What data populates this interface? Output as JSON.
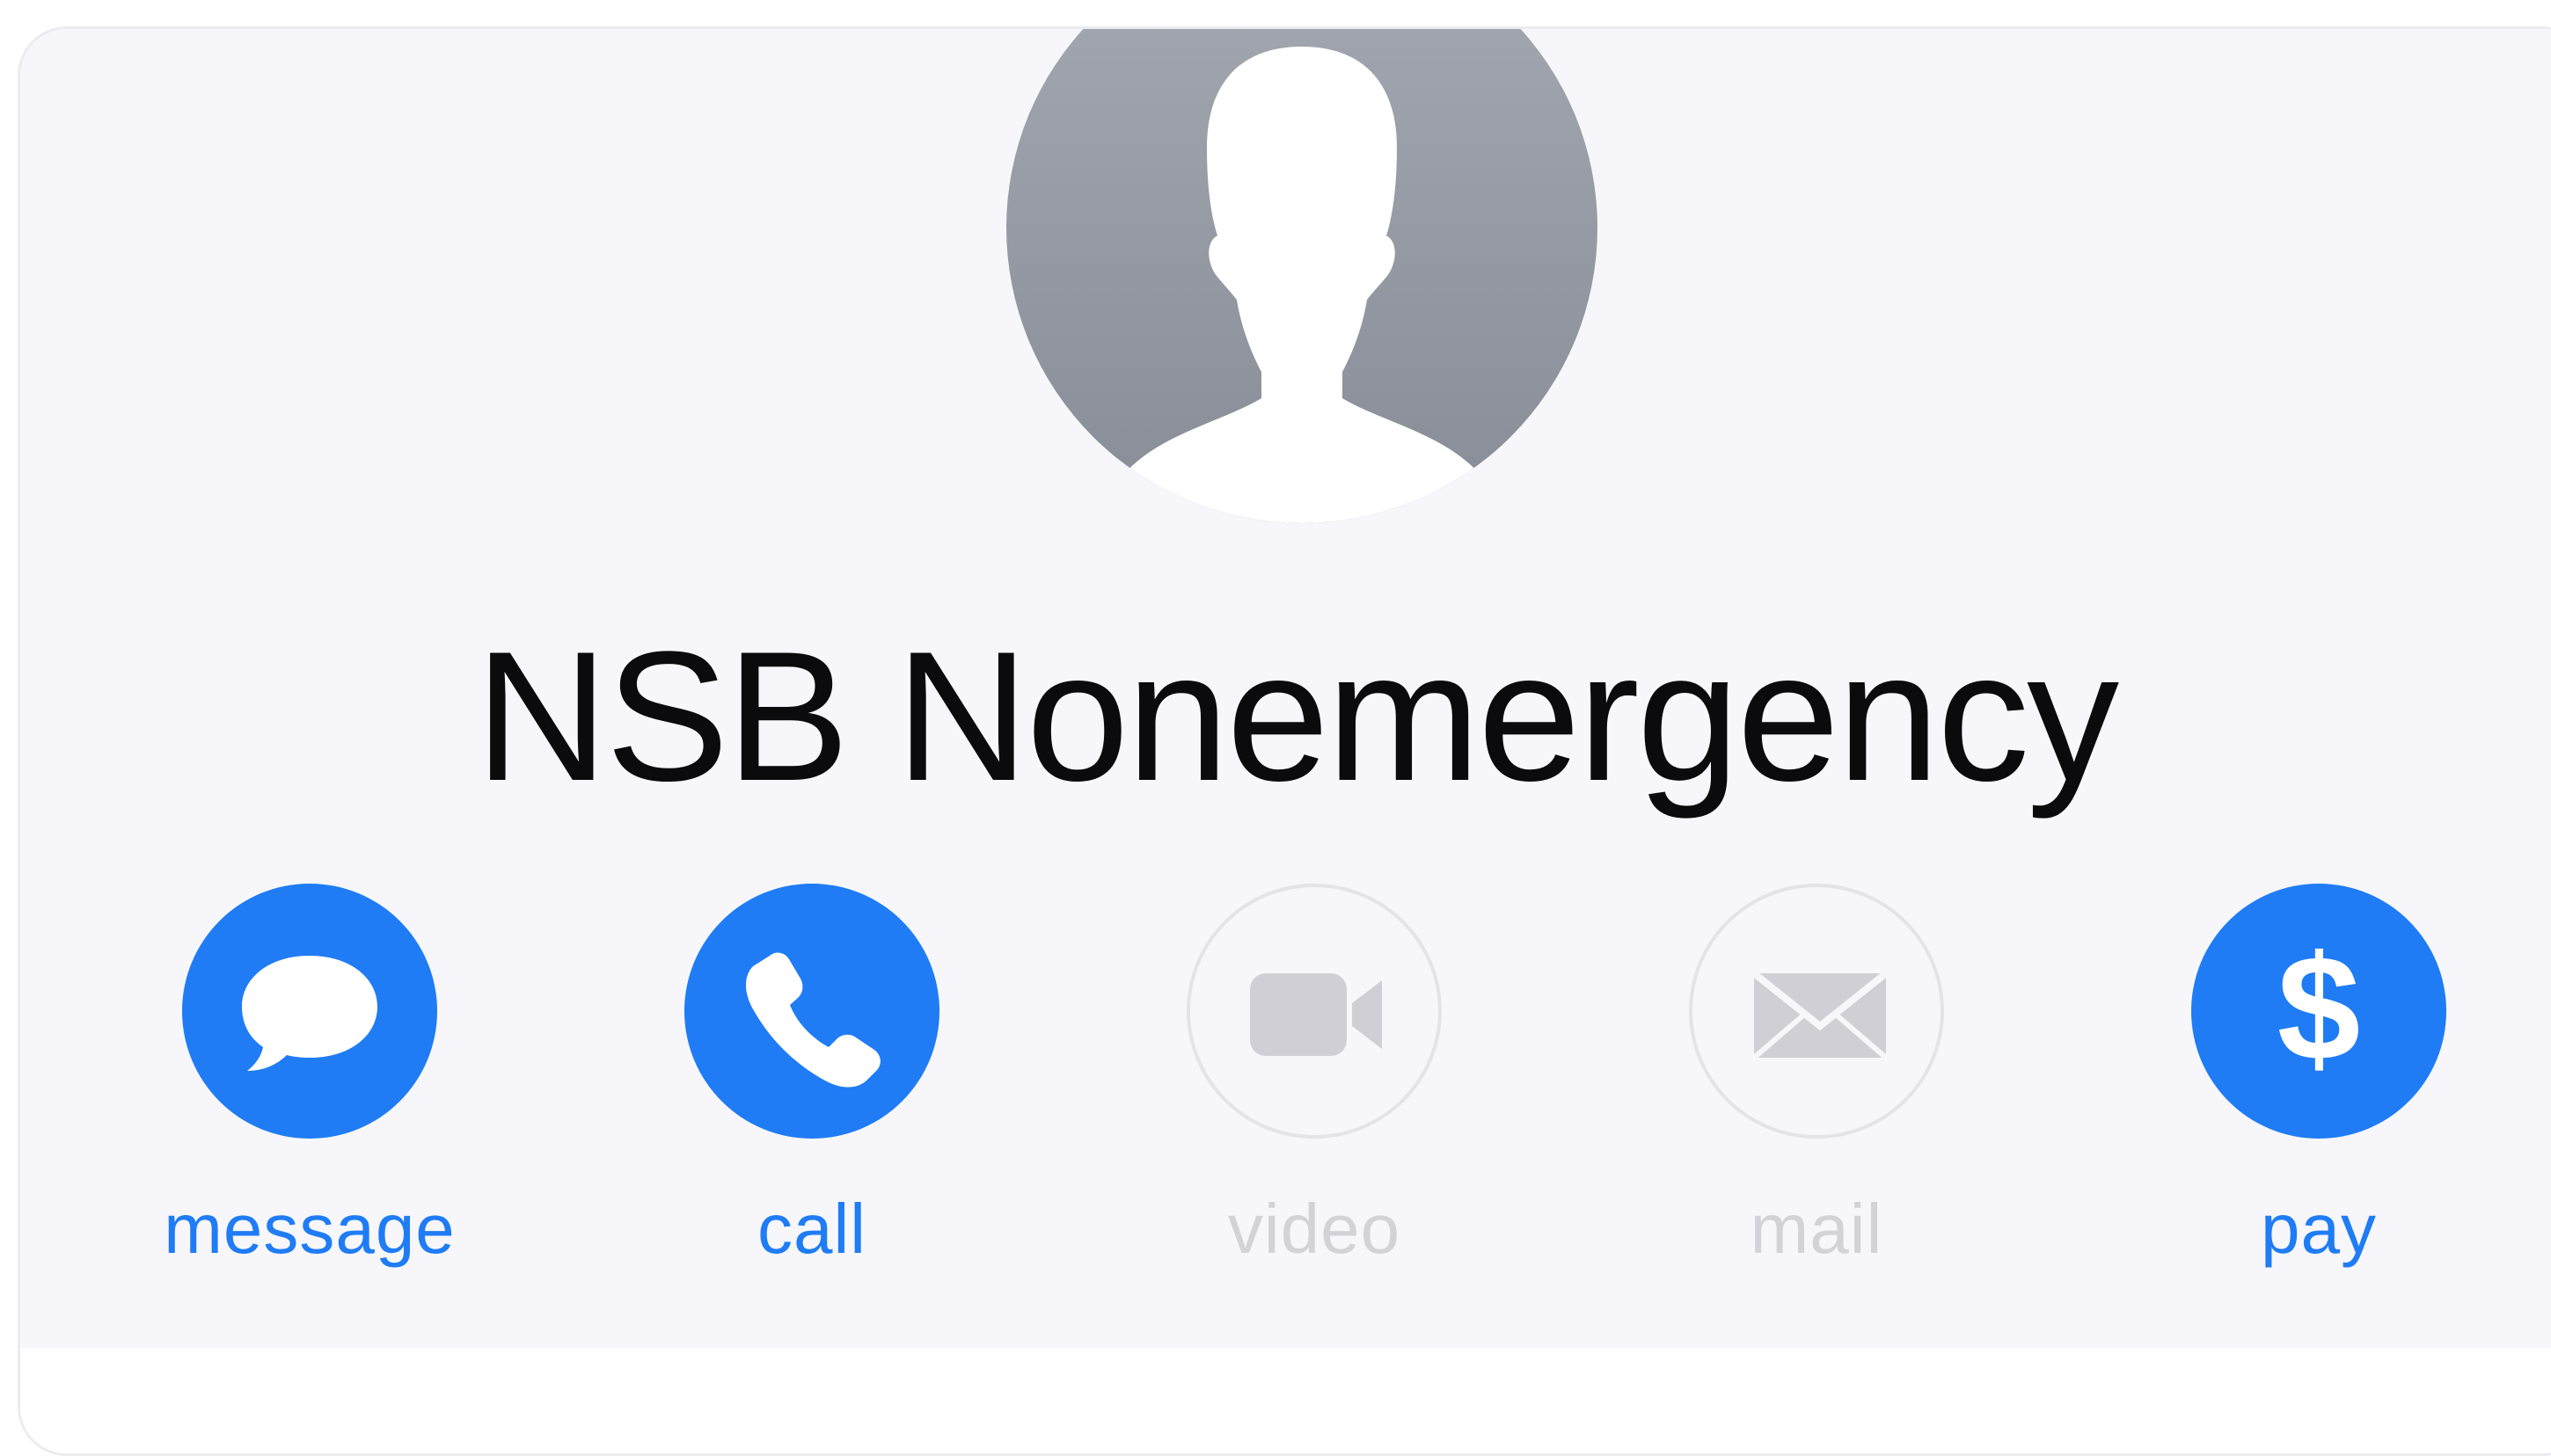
{
  "contact": {
    "name": "NSB Nonemergency",
    "avatar_icon": "person-silhouette-icon"
  },
  "actions": [
    {
      "id": "message",
      "label": "message",
      "icon": "speech-bubble-icon",
      "enabled": true
    },
    {
      "id": "call",
      "label": "call",
      "icon": "phone-icon",
      "enabled": true
    },
    {
      "id": "video",
      "label": "video",
      "icon": "video-camera-icon",
      "enabled": false
    },
    {
      "id": "mail",
      "label": "mail",
      "icon": "envelope-icon",
      "enabled": false
    },
    {
      "id": "pay",
      "label": "pay",
      "icon": "dollar-icon",
      "enabled": true
    }
  ],
  "colors": {
    "accent": "#1f7cf5",
    "disabled": "#d2d2d8",
    "background": "#f7f7fb",
    "avatar_top": "#9ea2ac",
    "avatar_bottom": "#8a8e98",
    "text": "#0b0b0d"
  }
}
